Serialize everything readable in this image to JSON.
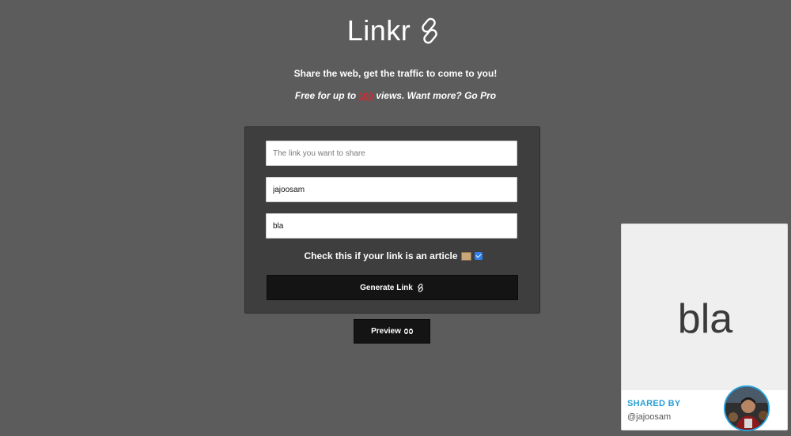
{
  "header": {
    "app_name": "Linkr",
    "logo_icon": "link-icon",
    "tagline": "Share the web, get the traffic to come to you!",
    "promo_prefix": "Free for up to",
    "promo_count": "100",
    "promo_suffix": "views. Want more?",
    "go_pro": "Go Pro"
  },
  "form": {
    "link_placeholder": "The link you want to share",
    "link_value": "",
    "username_value": "jajoosam",
    "text_value": "bla",
    "article_label": "Check this if your link is an article",
    "article_icon": "scroll-icon",
    "article_checked": true,
    "generate_label": "Generate Link",
    "generate_icon": "link-icon"
  },
  "preview_button": {
    "label": "Preview",
    "icon": "eyes-icon"
  },
  "preview_card": {
    "text": "bla",
    "shared_by_label": "SHARED BY",
    "username": "@jajoosam"
  },
  "colors": {
    "background": "#5c5c5c",
    "card": "#3e3e3e",
    "button": "#141414",
    "accent": "#2a9fd6",
    "promo_red": "#e0242e"
  }
}
